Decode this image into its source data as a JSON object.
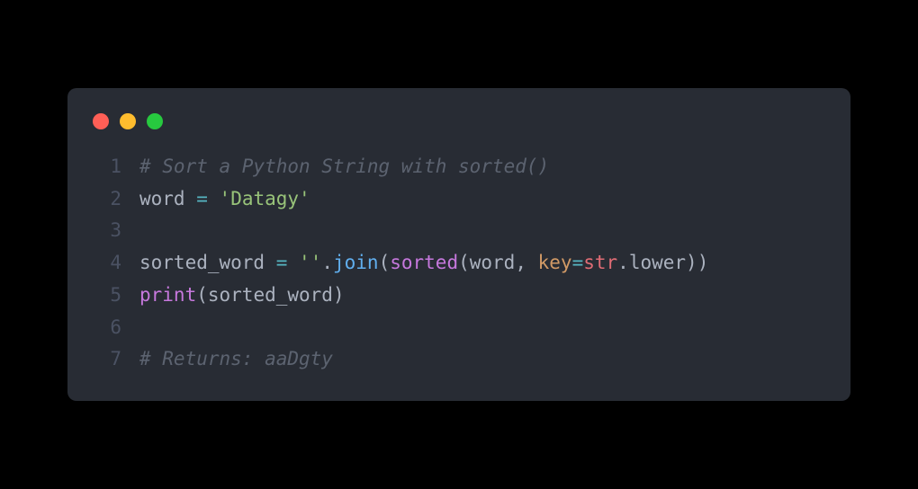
{
  "traffic_lights": {
    "red": "close",
    "yellow": "minimize",
    "green": "maximize"
  },
  "code": {
    "lines": [
      {
        "num": "1"
      },
      {
        "num": "2"
      },
      {
        "num": "3"
      },
      {
        "num": "4"
      },
      {
        "num": "5"
      },
      {
        "num": "6"
      },
      {
        "num": "7"
      }
    ],
    "tokens": {
      "l1_comment": "# Sort a Python String with sorted()",
      "l2_var": "word",
      "l2_sp1": " ",
      "l2_op": "=",
      "l2_sp2": " ",
      "l2_str": "'Datagy'",
      "l3_empty": "",
      "l4_var1": "sorted_word",
      "l4_sp1": " ",
      "l4_op": "=",
      "l4_sp2": " ",
      "l4_str": "''",
      "l4_dot1": ".",
      "l4_join": "join",
      "l4_p1": "(",
      "l4_sorted": "sorted",
      "l4_p2": "(",
      "l4_var2": "word",
      "l4_comma": ", ",
      "l4_key": "key",
      "l4_eq": "=",
      "l4_strobj": "str",
      "l4_dot2": ".",
      "l4_lower": "lower",
      "l4_p3": ")",
      "l4_p4": ")",
      "l5_print": "print",
      "l5_p1": "(",
      "l5_var": "sorted_word",
      "l5_p2": ")",
      "l6_empty": "",
      "l7_comment": "# Returns: aaDgty"
    }
  }
}
